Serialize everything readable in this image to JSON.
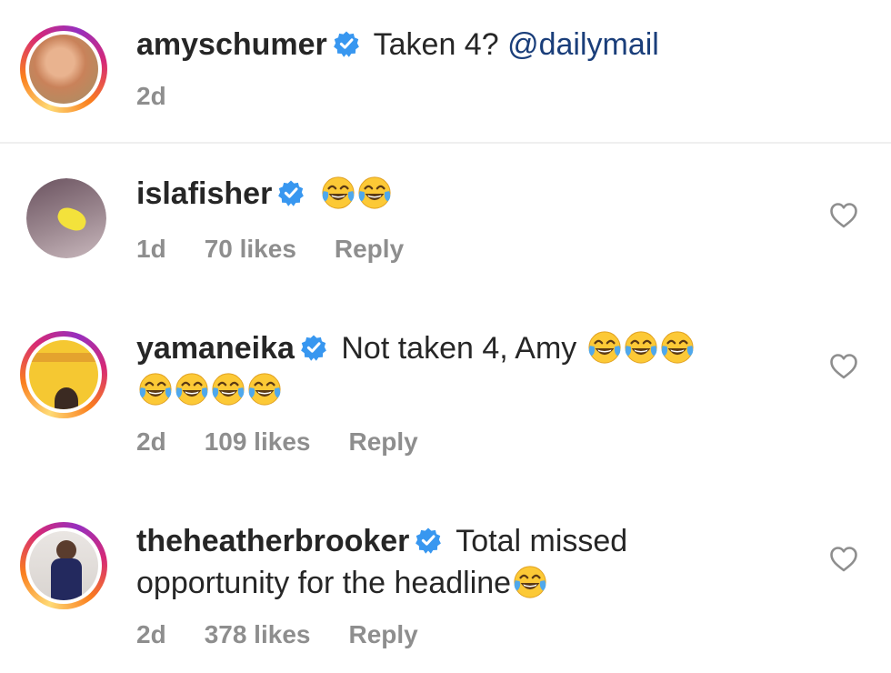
{
  "comments": [
    {
      "username": "amyschumer",
      "verified": true,
      "text": "Taken 4?",
      "mention": "@dailymail",
      "time": "2d",
      "avatar": "amy-avatar",
      "story_ring": true
    },
    {
      "username": "islafisher",
      "verified": true,
      "text": "",
      "emoji_count": 2,
      "time": "1d",
      "likes": "70 likes",
      "reply": "Reply",
      "avatar": "isla-avatar"
    },
    {
      "username": "yamaneika",
      "verified": true,
      "text": "Not taken 4, Amy",
      "emoji_count_line1": 3,
      "emoji_count_line2": 4,
      "time": "2d",
      "likes": "109 likes",
      "reply": "Reply",
      "avatar": "yamaneika-avatar",
      "story_ring": true
    },
    {
      "username": "theheatherbrooker",
      "verified": true,
      "text_line1": "Total missed",
      "text_line2": "opportunity for the headline",
      "emoji_count": 1,
      "time": "2d",
      "likes": "378 likes",
      "reply": "Reply",
      "avatar": "heather-avatar",
      "story_ring": true
    }
  ],
  "icons": {
    "verified": "verified-badge-icon",
    "like": "heart-icon",
    "emoji": "face-with-tears-of-joy-emoji"
  },
  "colors": {
    "verified_blue": "#3897f0",
    "mention": "#1a3e7a",
    "meta_gray": "#8e8e8e"
  }
}
